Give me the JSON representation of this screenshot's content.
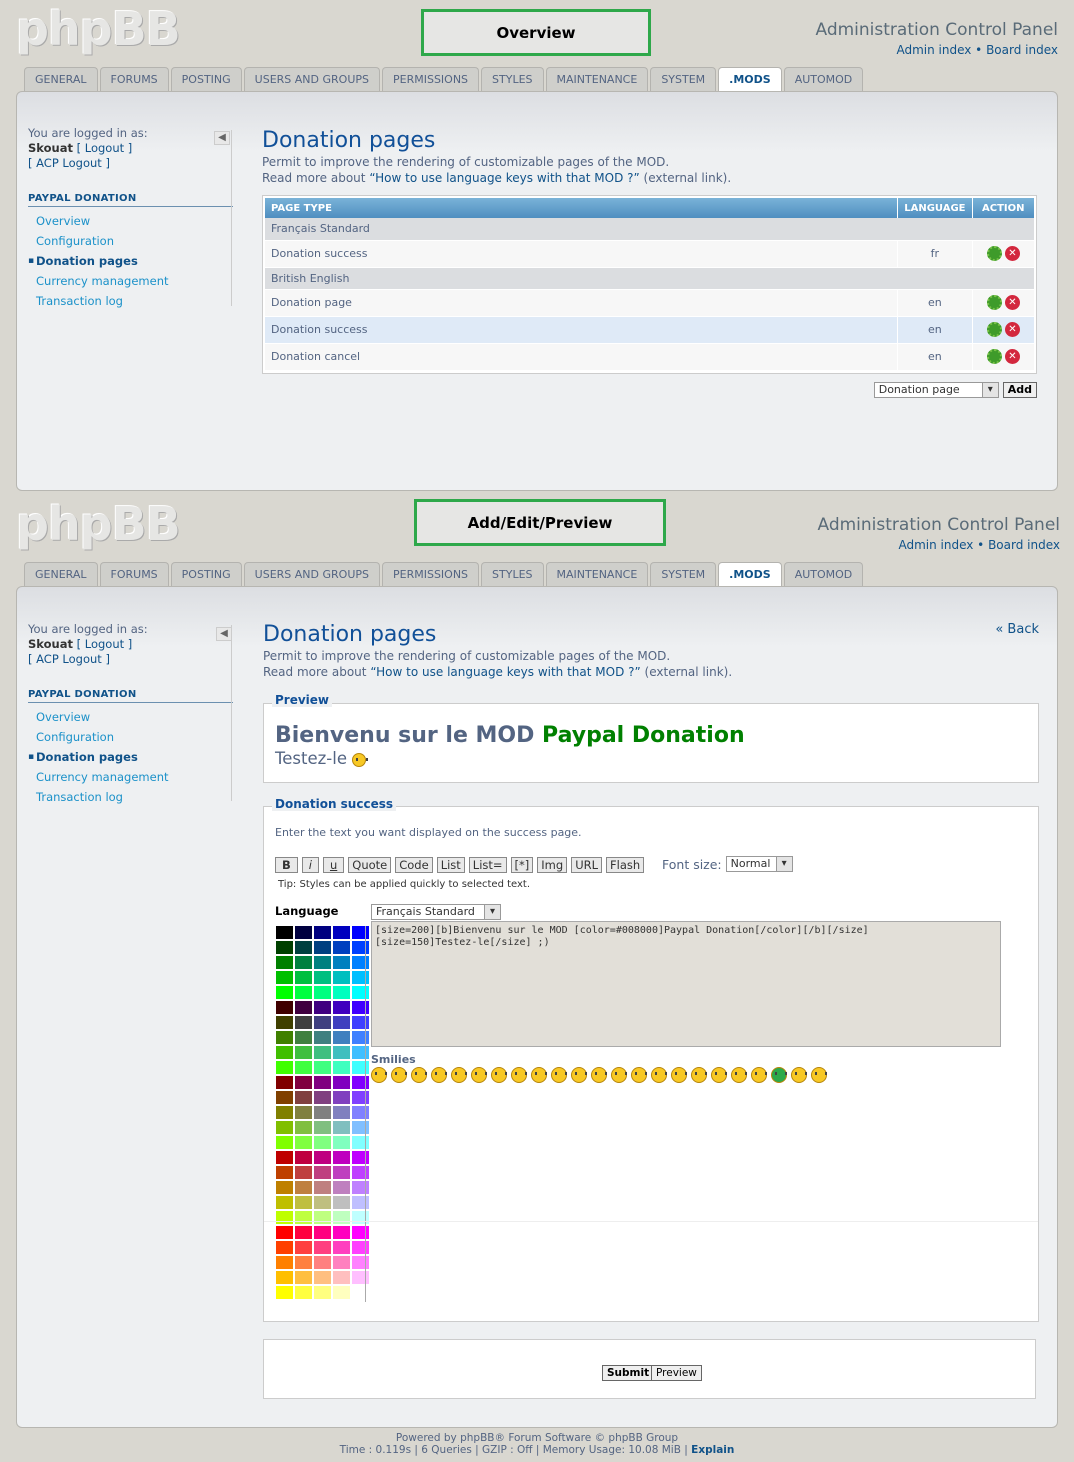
{
  "screens": [
    {
      "banner": "Overview"
    },
    {
      "banner": "Add/Edit/Preview"
    }
  ],
  "header": {
    "logo": "phpBB",
    "acp_title": "Administration Control Panel",
    "admin_index": "Admin index",
    "sep": "•",
    "board_index": "Board index"
  },
  "tabs": [
    "GENERAL",
    "FORUMS",
    "POSTING",
    "USERS AND GROUPS",
    "PERMISSIONS",
    "STYLES",
    "MAINTENANCE",
    "SYSTEM",
    ".MODS",
    "AUTOMOD"
  ],
  "menu": {
    "logged_as": "You are logged in as:",
    "user": "Skouat",
    "logout": "[ Logout ]",
    "acp_logout": "[ ACP Logout ]",
    "section": "PAYPAL DONATION",
    "items": [
      "Overview",
      "Configuration",
      "Donation pages",
      "Currency management",
      "Transaction log"
    ]
  },
  "main": {
    "title": "Donation pages",
    "desc1": "Permit to improve the rendering of customizable pages of the MOD.",
    "desc2_pre": "Read more about ",
    "desc2_link": "“How to use language keys with that MOD ?”",
    "desc2_post": " (external link).",
    "back": "« Back"
  },
  "table": {
    "headers": [
      "PAGE TYPE",
      "LANGUAGE",
      "ACTION"
    ],
    "groups": [
      {
        "name": "Français Standard",
        "rows": [
          {
            "type": "Donation success",
            "lang": "fr"
          }
        ]
      },
      {
        "name": "British English",
        "rows": [
          {
            "type": "Donation page",
            "lang": "en"
          },
          {
            "type": "Donation success",
            "lang": "en"
          },
          {
            "type": "Donation cancel",
            "lang": "en"
          }
        ]
      }
    ],
    "add_select": "Donation page",
    "add_btn": "Add"
  },
  "preview": {
    "legend": "Preview",
    "line1_a": "Bienvenu sur le MOD ",
    "line1_b": "Paypal Donation",
    "line2": "Testez-le",
    "green": "#008000"
  },
  "editor": {
    "legend": "Donation success",
    "explain": "Enter the text you want displayed on the success page.",
    "buttons": [
      "B",
      "i",
      "u",
      "Quote",
      "Code",
      "List",
      "List=",
      "[*]",
      "Img",
      "URL",
      "Flash"
    ],
    "font_size_label": "Font size:",
    "font_size": "Normal",
    "tip": "Tip: Styles can be applied quickly to selected text.",
    "language_label": "Language",
    "language": "Français Standard",
    "text": "[size=200][b]Bienvenu sur le MOD [color=#008000]Paypal Donation[/color][/b][/size]\n[size=150]Testez-le[/size] ;)",
    "smilies_label": "Smilies",
    "submit": "Submit",
    "preview_btn": "Preview"
  },
  "footer": {
    "line1": "Powered by phpBB® Forum Software © phpBB Group",
    "line2": "Time : 0.119s | 6 Queries | GZIP : Off | Memory Usage: 10.08 MiB |",
    "explain": "Explain"
  }
}
